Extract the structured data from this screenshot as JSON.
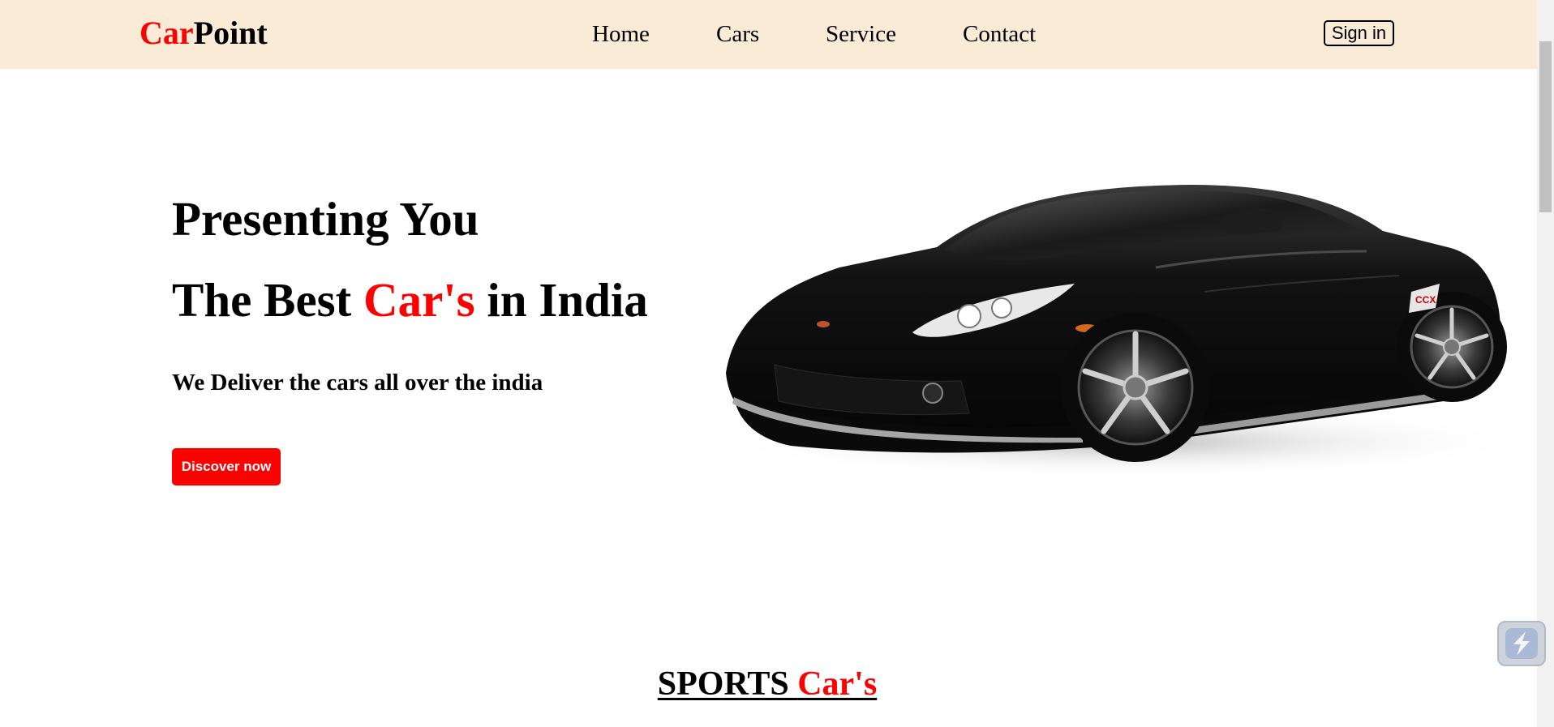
{
  "header": {
    "logo": {
      "part1": "Car",
      "part2": "Point"
    },
    "nav": [
      {
        "label": "Home"
      },
      {
        "label": "Cars"
      },
      {
        "label": "Service"
      },
      {
        "label": "Contact"
      }
    ],
    "signin_label": "Sign in"
  },
  "hero": {
    "line1": "Presenting You",
    "line2_prefix": "The Best ",
    "line2_highlight": "Car's",
    "line2_suffix": " in India",
    "subtitle": "We Deliver the cars all over the india",
    "cta_label": "Discover now"
  },
  "sports_section": {
    "title_prefix": "SPORTS ",
    "title_highlight": "Car's"
  },
  "colors": {
    "accent": "#ff0000",
    "navbar_bg": "#faebd7"
  },
  "icons": {
    "car_image": "black-sports-car",
    "floating_widget": "lightning-bolt-icon"
  }
}
